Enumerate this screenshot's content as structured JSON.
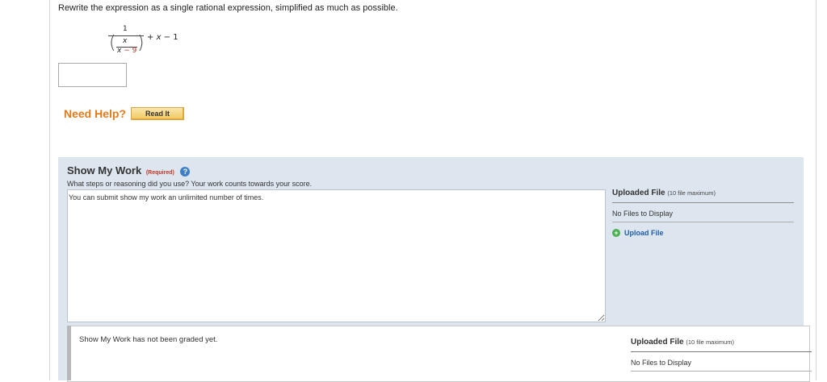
{
  "question": {
    "prompt": "Rewrite the expression as a single rational expression, simplified as much as possible."
  },
  "expression": {
    "outer_numerator": "1",
    "inner_numerator": "x",
    "inner_denominator_var": "x",
    "inner_denominator_rest": " − 9",
    "plus_x": "+ ",
    "plus_var": "x",
    "plus_rest": " − 1"
  },
  "answer": {
    "value": ""
  },
  "help": {
    "need_help": "Need Help?",
    "read_it": "Read It"
  },
  "show_my_work": {
    "title": "Show My Work",
    "required": "(Required)",
    "question": "What steps or reasoning did you use? Your work counts towards your score.",
    "unlimited": "You can submit show my work an unlimited number of times.",
    "work_value": ""
  },
  "upload": {
    "title": "Uploaded File",
    "max": "(10 file maximum)",
    "no_files": "No Files to Display",
    "upload_label": "Upload File"
  },
  "graded": {
    "status": "Show My Work has not been graded yet.",
    "upload_title": "Uploaded File",
    "upload_max": "(10 file maximum)",
    "no_files": "No Files to Display"
  },
  "colors": {
    "need_help": "#e07b1c",
    "panel_bg": "#dde6ef",
    "link": "#1f5ea8",
    "required": "#c0392b"
  }
}
